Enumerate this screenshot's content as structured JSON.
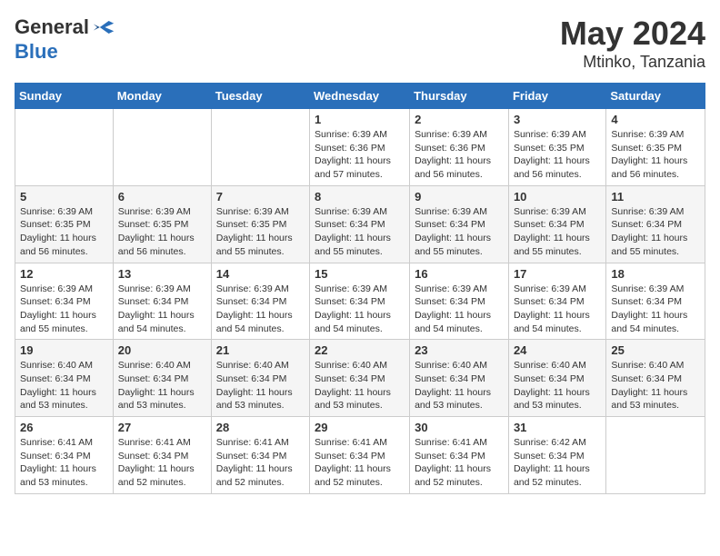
{
  "logo": {
    "general": "General",
    "blue": "Blue"
  },
  "title": {
    "month": "May 2024",
    "location": "Mtinko, Tanzania"
  },
  "weekdays": [
    "Sunday",
    "Monday",
    "Tuesday",
    "Wednesday",
    "Thursday",
    "Friday",
    "Saturday"
  ],
  "weeks": [
    [
      {
        "day": "",
        "info": ""
      },
      {
        "day": "",
        "info": ""
      },
      {
        "day": "",
        "info": ""
      },
      {
        "day": "1",
        "info": "Sunrise: 6:39 AM\nSunset: 6:36 PM\nDaylight: 11 hours\nand 57 minutes."
      },
      {
        "day": "2",
        "info": "Sunrise: 6:39 AM\nSunset: 6:36 PM\nDaylight: 11 hours\nand 56 minutes."
      },
      {
        "day": "3",
        "info": "Sunrise: 6:39 AM\nSunset: 6:35 PM\nDaylight: 11 hours\nand 56 minutes."
      },
      {
        "day": "4",
        "info": "Sunrise: 6:39 AM\nSunset: 6:35 PM\nDaylight: 11 hours\nand 56 minutes."
      }
    ],
    [
      {
        "day": "5",
        "info": "Sunrise: 6:39 AM\nSunset: 6:35 PM\nDaylight: 11 hours\nand 56 minutes."
      },
      {
        "day": "6",
        "info": "Sunrise: 6:39 AM\nSunset: 6:35 PM\nDaylight: 11 hours\nand 56 minutes."
      },
      {
        "day": "7",
        "info": "Sunrise: 6:39 AM\nSunset: 6:35 PM\nDaylight: 11 hours\nand 55 minutes."
      },
      {
        "day": "8",
        "info": "Sunrise: 6:39 AM\nSunset: 6:34 PM\nDaylight: 11 hours\nand 55 minutes."
      },
      {
        "day": "9",
        "info": "Sunrise: 6:39 AM\nSunset: 6:34 PM\nDaylight: 11 hours\nand 55 minutes."
      },
      {
        "day": "10",
        "info": "Sunrise: 6:39 AM\nSunset: 6:34 PM\nDaylight: 11 hours\nand 55 minutes."
      },
      {
        "day": "11",
        "info": "Sunrise: 6:39 AM\nSunset: 6:34 PM\nDaylight: 11 hours\nand 55 minutes."
      }
    ],
    [
      {
        "day": "12",
        "info": "Sunrise: 6:39 AM\nSunset: 6:34 PM\nDaylight: 11 hours\nand 55 minutes."
      },
      {
        "day": "13",
        "info": "Sunrise: 6:39 AM\nSunset: 6:34 PM\nDaylight: 11 hours\nand 54 minutes."
      },
      {
        "day": "14",
        "info": "Sunrise: 6:39 AM\nSunset: 6:34 PM\nDaylight: 11 hours\nand 54 minutes."
      },
      {
        "day": "15",
        "info": "Sunrise: 6:39 AM\nSunset: 6:34 PM\nDaylight: 11 hours\nand 54 minutes."
      },
      {
        "day": "16",
        "info": "Sunrise: 6:39 AM\nSunset: 6:34 PM\nDaylight: 11 hours\nand 54 minutes."
      },
      {
        "day": "17",
        "info": "Sunrise: 6:39 AM\nSunset: 6:34 PM\nDaylight: 11 hours\nand 54 minutes."
      },
      {
        "day": "18",
        "info": "Sunrise: 6:39 AM\nSunset: 6:34 PM\nDaylight: 11 hours\nand 54 minutes."
      }
    ],
    [
      {
        "day": "19",
        "info": "Sunrise: 6:40 AM\nSunset: 6:34 PM\nDaylight: 11 hours\nand 53 minutes."
      },
      {
        "day": "20",
        "info": "Sunrise: 6:40 AM\nSunset: 6:34 PM\nDaylight: 11 hours\nand 53 minutes."
      },
      {
        "day": "21",
        "info": "Sunrise: 6:40 AM\nSunset: 6:34 PM\nDaylight: 11 hours\nand 53 minutes."
      },
      {
        "day": "22",
        "info": "Sunrise: 6:40 AM\nSunset: 6:34 PM\nDaylight: 11 hours\nand 53 minutes."
      },
      {
        "day": "23",
        "info": "Sunrise: 6:40 AM\nSunset: 6:34 PM\nDaylight: 11 hours\nand 53 minutes."
      },
      {
        "day": "24",
        "info": "Sunrise: 6:40 AM\nSunset: 6:34 PM\nDaylight: 11 hours\nand 53 minutes."
      },
      {
        "day": "25",
        "info": "Sunrise: 6:40 AM\nSunset: 6:34 PM\nDaylight: 11 hours\nand 53 minutes."
      }
    ],
    [
      {
        "day": "26",
        "info": "Sunrise: 6:41 AM\nSunset: 6:34 PM\nDaylight: 11 hours\nand 53 minutes."
      },
      {
        "day": "27",
        "info": "Sunrise: 6:41 AM\nSunset: 6:34 PM\nDaylight: 11 hours\nand 52 minutes."
      },
      {
        "day": "28",
        "info": "Sunrise: 6:41 AM\nSunset: 6:34 PM\nDaylight: 11 hours\nand 52 minutes."
      },
      {
        "day": "29",
        "info": "Sunrise: 6:41 AM\nSunset: 6:34 PM\nDaylight: 11 hours\nand 52 minutes."
      },
      {
        "day": "30",
        "info": "Sunrise: 6:41 AM\nSunset: 6:34 PM\nDaylight: 11 hours\nand 52 minutes."
      },
      {
        "day": "31",
        "info": "Sunrise: 6:42 AM\nSunset: 6:34 PM\nDaylight: 11 hours\nand 52 minutes."
      },
      {
        "day": "",
        "info": ""
      }
    ]
  ]
}
